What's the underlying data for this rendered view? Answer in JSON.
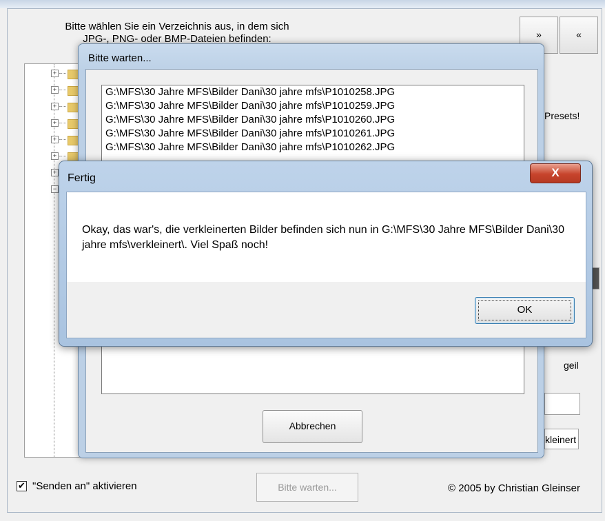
{
  "main": {
    "instructions": [
      "Bitte wählen Sie ein Verzeichnis aus, in dem sich",
      "JPG-, PNG- oder BMP-Dateien befinden:"
    ],
    "nav_forward": "»",
    "nav_back": "«",
    "presets_text": "Presets!",
    "geil_text": "geil",
    "kleinert_text": "kleinert",
    "sendto_label": "\"Senden an\" aktivieren",
    "sendto_checked": "✔",
    "wait_button": "Bitte warten...",
    "copyright": "© 2005 by Christian Gleinser"
  },
  "wait_dialog": {
    "title": "Bitte warten...",
    "files": [
      "G:\\MFS\\30 Jahre MFS\\Bilder Dani\\30 jahre mfs\\P1010258.JPG",
      "G:\\MFS\\30 Jahre MFS\\Bilder Dani\\30 jahre mfs\\P1010259.JPG",
      "G:\\MFS\\30 Jahre MFS\\Bilder Dani\\30 jahre mfs\\P1010260.JPG",
      "G:\\MFS\\30 Jahre MFS\\Bilder Dani\\30 jahre mfs\\P1010261.JPG",
      "G:\\MFS\\30 Jahre MFS\\Bilder Dani\\30 jahre mfs\\P1010262.JPG"
    ],
    "abort_button": "Abbrechen"
  },
  "done_dialog": {
    "title": "Fertig",
    "close_glyph": "X",
    "message": "Okay, das war's, die verkleinerten Bilder befinden sich nun in G:\\MFS\\30 Jahre MFS\\Bilder Dani\\30 jahre mfs\\verkleinert\\. Viel Spaß noch!",
    "ok_button": "OK"
  }
}
